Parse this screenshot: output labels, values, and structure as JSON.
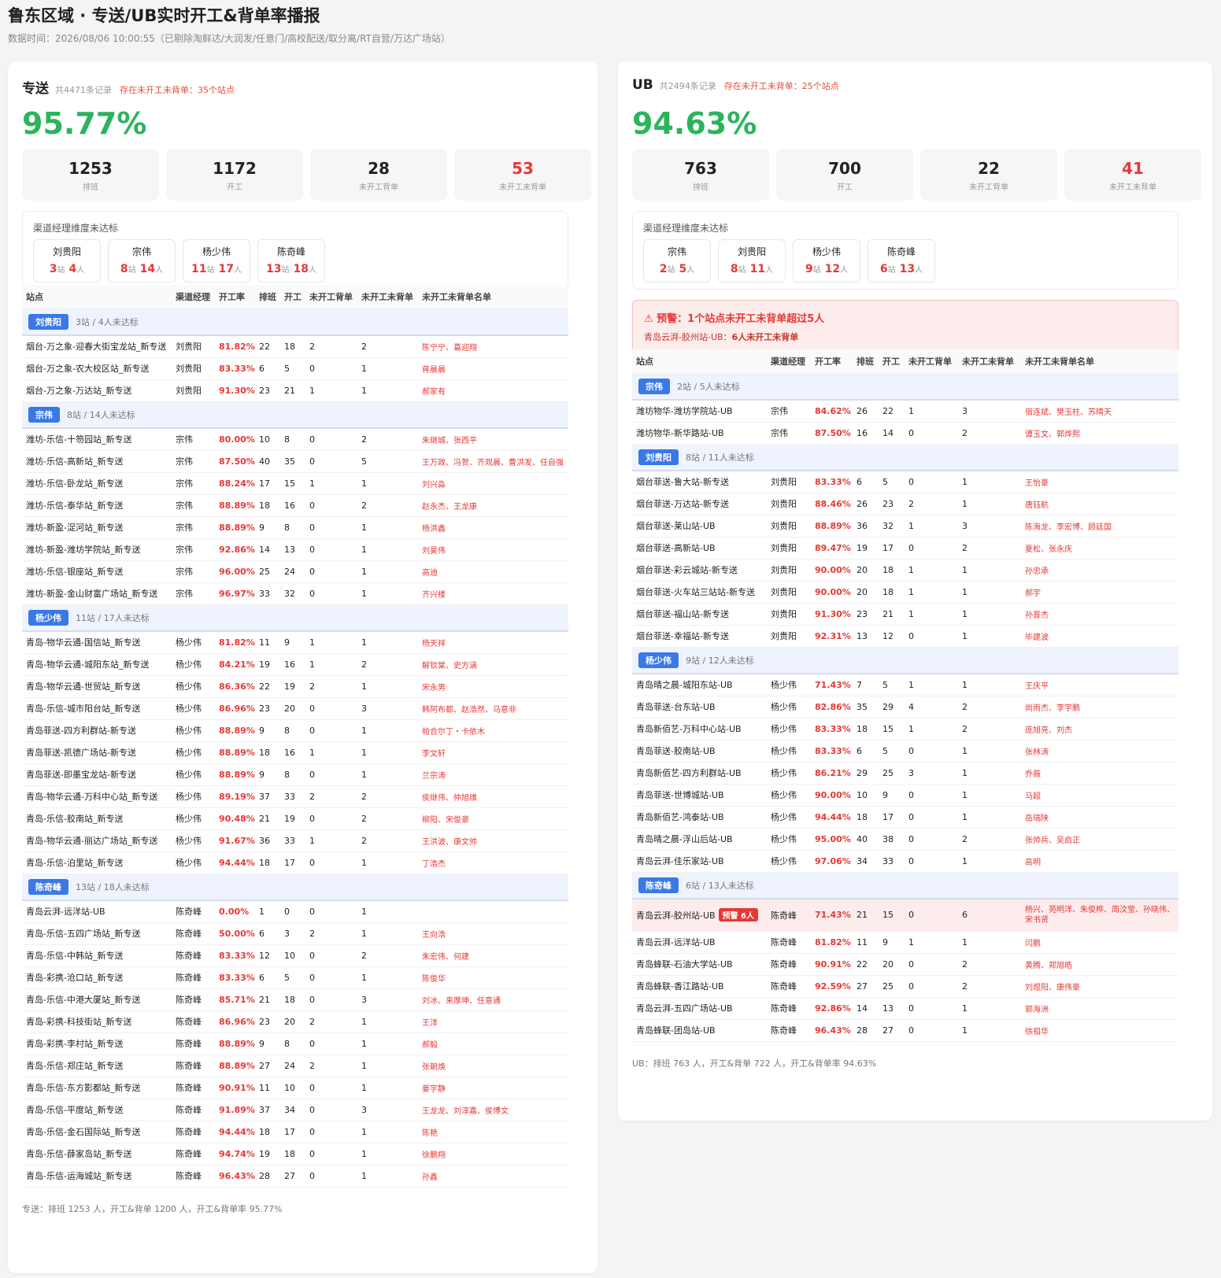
{
  "header": {
    "title": "鲁东区域 · 专送/UB实时开工&背单率播报",
    "subtitle": "数据时间：2026/08/06 10:00:55（已剔除淘鲜达/大润发/任意门/高校配送/取分离/RT自营/万达广场站）"
  },
  "left": {
    "name": "专送",
    "count": "共4471条记录",
    "warn": "存在未开工未背单：35个站点",
    "rate": "95.77%",
    "stats": [
      {
        "value": "1253",
        "label": "排班"
      },
      {
        "value": "1172",
        "label": "开工"
      },
      {
        "value": "28",
        "label": "未开工背单"
      },
      {
        "value": "53",
        "label": "未开工未背单"
      }
    ],
    "mgr_title": "渠道经理维度未达标",
    "managers": [
      {
        "name": "刘贵阳",
        "sites": "3",
        "people": "4"
      },
      {
        "name": "宗伟",
        "sites": "8",
        "people": "14"
      },
      {
        "name": "杨少伟",
        "sites": "11",
        "people": "17"
      },
      {
        "name": "陈奇峰",
        "sites": "13",
        "people": "18"
      }
    ],
    "unit_site": "站",
    "unit_people": "人",
    "columns": [
      "站点",
      "渠道经理",
      "开工率",
      "排班",
      "开工",
      "未开工背单",
      "未开工未背单",
      "未开工未背单名单"
    ],
    "groups": [
      {
        "manager": "刘贵阳",
        "summary": "3站 / 4人未达标",
        "rows": [
          [
            "烟台-万之象-迎春大街宝龙站_新专送",
            "刘贵阳",
            "81.82%",
            "22",
            "18",
            "2",
            "2",
            "陈宁宁、葛迎翔"
          ],
          [
            "烟台-万之象-农大校区站_新专送",
            "刘贵阳",
            "83.33%",
            "6",
            "5",
            "0",
            "1",
            "蒋晨晨"
          ],
          [
            "烟台-万之象-万达站_新专送",
            "刘贵阳",
            "91.30%",
            "23",
            "21",
            "1",
            "1",
            "郝家有"
          ]
        ]
      },
      {
        "manager": "宗伟",
        "summary": "8站 / 14人未达标",
        "rows": [
          [
            "潍坊-乐信-十笏园站_新专送",
            "宗伟",
            "80.00%",
            "10",
            "8",
            "0",
            "2",
            "朱继城、张西平"
          ],
          [
            "潍坊-乐信-高新站_新专送",
            "宗伟",
            "87.50%",
            "40",
            "35",
            "0",
            "5",
            "王万政、冯贺、齐观晨、曹洪发、任自强"
          ],
          [
            "潍坊-乐信-卧龙站_新专送",
            "宗伟",
            "88.24%",
            "17",
            "15",
            "1",
            "1",
            "刘兴淼"
          ],
          [
            "潍坊-乐信-泰华站_新专送",
            "宗伟",
            "88.89%",
            "18",
            "16",
            "0",
            "2",
            "赵永杰、王龙康"
          ],
          [
            "潍坊-新盈-浞河站_新专送",
            "宗伟",
            "88.89%",
            "9",
            "8",
            "0",
            "1",
            "杨洪鑫"
          ],
          [
            "潍坊-新盈-潍坊学院站_新专送",
            "宗伟",
            "92.86%",
            "14",
            "13",
            "0",
            "1",
            "刘昊伟"
          ],
          [
            "潍坊-乐信-银座站_新专送",
            "宗伟",
            "96.00%",
            "25",
            "24",
            "0",
            "1",
            "高迪"
          ],
          [
            "潍坊-新盈-金山财富广场站_新专送",
            "宗伟",
            "96.97%",
            "33",
            "32",
            "0",
            "1",
            "齐兴楼"
          ]
        ]
      },
      {
        "manager": "杨少伟",
        "summary": "11站 / 17人未达标",
        "rows": [
          [
            "青岛-物华云通-国信站_新专送",
            "杨少伟",
            "81.82%",
            "11",
            "9",
            "1",
            "1",
            "杨天祥"
          ],
          [
            "青岛-物华云通-城阳东站_新专送",
            "杨少伟",
            "84.21%",
            "19",
            "16",
            "1",
            "2",
            "解钦棠、史方涵"
          ],
          [
            "青岛-物华云通-世贸站_新专送",
            "杨少伟",
            "86.36%",
            "22",
            "19",
            "2",
            "1",
            "宋永男"
          ],
          [
            "青岛-乐信-城市阳台站_新专送",
            "杨少伟",
            "86.96%",
            "23",
            "20",
            "0",
            "3",
            "韩阿布都、赵浩然、马意非"
          ],
          [
            "青岛菲送-四方利群站-新专送",
            "杨少伟",
            "88.89%",
            "9",
            "8",
            "0",
            "1",
            "帕合尔丁・卡依木"
          ],
          [
            "青岛菲送-凯德广场站-新专送",
            "杨少伟",
            "88.89%",
            "18",
            "16",
            "1",
            "1",
            "李文轩"
          ],
          [
            "青岛菲送-即墨宝龙站-新专送",
            "杨少伟",
            "88.89%",
            "9",
            "8",
            "0",
            "1",
            "兰宗涛"
          ],
          [
            "青岛-物华云通-万科中心站_新专送",
            "杨少伟",
            "89.19%",
            "37",
            "33",
            "2",
            "2",
            "侯继伟、仲旭维"
          ],
          [
            "青岛-乐信-胶南站_新专送",
            "杨少伟",
            "90.48%",
            "21",
            "19",
            "0",
            "2",
            "柳阳、宋俊豪"
          ],
          [
            "青岛-物华云通-丽达广场站_新专送",
            "杨少伟",
            "91.67%",
            "36",
            "33",
            "1",
            "2",
            "王洪波、康文帅"
          ],
          [
            "青岛-乐信-泊里站_新专送",
            "杨少伟",
            "94.44%",
            "18",
            "17",
            "0",
            "1",
            "丁浩杰"
          ]
        ]
      },
      {
        "manager": "陈奇峰",
        "summary": "13站 / 18人未达标",
        "rows": [
          [
            "青岛云湃-远洋站-UB",
            "陈奇峰",
            "0.00%",
            "1",
            "0",
            "0",
            "1",
            ""
          ],
          [
            "青岛-乐信-五四广场站_新专送",
            "陈奇峰",
            "50.00%",
            "6",
            "3",
            "2",
            "1",
            "王向浩"
          ],
          [
            "青岛-乐信-中韩站_新专送",
            "陈奇峰",
            "83.33%",
            "12",
            "10",
            "0",
            "2",
            "朱宏伟、何建"
          ],
          [
            "青岛-彩携-沧口站_新专送",
            "陈奇峰",
            "83.33%",
            "6",
            "5",
            "0",
            "1",
            "陈俊华"
          ],
          [
            "青岛-乐信-中港大厦站_新专送",
            "陈奇峰",
            "85.71%",
            "21",
            "18",
            "0",
            "3",
            "刘冰、来厚坤、任意通"
          ],
          [
            "青岛-彩携-科技街站_新专送",
            "陈奇峰",
            "86.96%",
            "23",
            "20",
            "2",
            "1",
            "王洋"
          ],
          [
            "青岛-彩携-李村站_新专送",
            "陈奇峰",
            "88.89%",
            "9",
            "8",
            "0",
            "1",
            "郝毅"
          ],
          [
            "青岛-乐信-郑庄站_新专送",
            "陈奇峰",
            "88.89%",
            "27",
            "24",
            "2",
            "1",
            "张朝焕"
          ],
          [
            "青岛-乐信-东方影都站_新专送",
            "陈奇峰",
            "90.91%",
            "11",
            "10",
            "0",
            "1",
            "姜宇静"
          ],
          [
            "青岛-乐信-平度站_新专送",
            "陈奇峰",
            "91.89%",
            "37",
            "34",
            "0",
            "3",
            "王龙龙、刘淳嘉、侯博文"
          ],
          [
            "青岛-乐信-金石国际站_新专送",
            "陈奇峰",
            "94.44%",
            "18",
            "17",
            "0",
            "1",
            "陈艳"
          ],
          [
            "青岛-乐信-薛家岛站_新专送",
            "陈奇峰",
            "94.74%",
            "19",
            "18",
            "0",
            "1",
            "徐鹏翔"
          ],
          [
            "青岛-乐信-运海城站_新专送",
            "陈奇峰",
            "96.43%",
            "28",
            "27",
            "0",
            "1",
            "孙鑫"
          ]
        ]
      }
    ],
    "footer": "专送：排班 1253 人，开工&背单 1200 人，开工&背单率 95.77%"
  },
  "right": {
    "name": "UB",
    "count": "共2494条记录",
    "warn": "存在未开工未背单：25个站点",
    "rate": "94.63%",
    "stats": [
      {
        "value": "763",
        "label": "排班"
      },
      {
        "value": "700",
        "label": "开工"
      },
      {
        "value": "22",
        "label": "未开工背单"
      },
      {
        "value": "41",
        "label": "未开工未背单"
      }
    ],
    "mgr_title": "渠道经理维度未达标",
    "managers": [
      {
        "name": "宗伟",
        "sites": "2",
        "people": "5"
      },
      {
        "name": "刘贵阳",
        "sites": "8",
        "people": "11"
      },
      {
        "name": "杨少伟",
        "sites": "9",
        "people": "12"
      },
      {
        "name": "陈奇峰",
        "sites": "6",
        "people": "13"
      }
    ],
    "unit_site": "站",
    "unit_people": "人",
    "alert": {
      "title": "⚠ 预警：1个站点未开工未背单超过5人",
      "site": "青岛云湃-胶州站-UB：",
      "detail": "6人未开工未背单"
    },
    "columns": [
      "站点",
      "渠道经理",
      "开工率",
      "排班",
      "开工",
      "未开工背单",
      "未开工未背单",
      "未开工未背单名单"
    ],
    "groups": [
      {
        "manager": "宗伟",
        "summary": "2站 / 5人未达标",
        "rows": [
          [
            "潍坊物华-潍坊学院站-UB",
            "宗伟",
            "84.62%",
            "26",
            "22",
            "1",
            "3",
            "宿连斌、樊玉柱、苏晴天"
          ],
          [
            "潍坊物华-新华路站-UB",
            "宗伟",
            "87.50%",
            "16",
            "14",
            "0",
            "2",
            "谭玉文、郭烨熙"
          ]
        ]
      },
      {
        "manager": "刘贵阳",
        "summary": "8站 / 11人未达标",
        "rows": [
          [
            "烟台菲送-鲁大站-新专送",
            "刘贵阳",
            "83.33%",
            "6",
            "5",
            "0",
            "1",
            "王怡豪"
          ],
          [
            "烟台菲送-万达站-新专送",
            "刘贵阳",
            "88.46%",
            "26",
            "23",
            "2",
            "1",
            "唐钰航"
          ],
          [
            "烟台菲送-莱山站-UB",
            "刘贵阳",
            "88.89%",
            "36",
            "32",
            "1",
            "3",
            "陈海龙、李宏博、顾廷国"
          ],
          [
            "烟台菲送-高新站-UB",
            "刘贵阳",
            "89.47%",
            "19",
            "17",
            "0",
            "2",
            "夏松、张永庆"
          ],
          [
            "烟台菲送-彩云城站-新专送",
            "刘贵阳",
            "90.00%",
            "20",
            "18",
            "1",
            "1",
            "孙忠承"
          ],
          [
            "烟台菲送-火车站三站站-新专送",
            "刘贵阳",
            "90.00%",
            "20",
            "18",
            "1",
            "1",
            "郝宇"
          ],
          [
            "烟台菲送-福山站-新专送",
            "刘贵阳",
            "91.30%",
            "23",
            "21",
            "1",
            "1",
            "孙晋杰"
          ],
          [
            "烟台菲送-幸福站-新专送",
            "刘贵阳",
            "92.31%",
            "13",
            "12",
            "0",
            "1",
            "毕建波"
          ]
        ]
      },
      {
        "manager": "杨少伟",
        "summary": "9站 / 12人未达标",
        "rows": [
          [
            "青岛晴之晨-城阳东站-UB",
            "杨少伟",
            "71.43%",
            "7",
            "5",
            "1",
            "1",
            "王庆平"
          ],
          [
            "青岛菲送-台东站-UB",
            "杨少伟",
            "82.86%",
            "35",
            "29",
            "4",
            "2",
            "尚雨杰、李宇鹏"
          ],
          [
            "青岛新佰艺-万科中心站-UB",
            "杨少伟",
            "83.33%",
            "18",
            "15",
            "1",
            "2",
            "庞旭亮、刘杰"
          ],
          [
            "青岛菲送-胶南站-UB",
            "杨少伟",
            "83.33%",
            "6",
            "5",
            "0",
            "1",
            "张林涛"
          ],
          [
            "青岛新佰艺-四方利群站-UB",
            "杨少伟",
            "86.21%",
            "29",
            "25",
            "3",
            "1",
            "乔薇"
          ],
          [
            "青岛菲送-世博城站-UB",
            "杨少伟",
            "90.00%",
            "10",
            "9",
            "0",
            "1",
            "马超"
          ],
          [
            "青岛新佰艺-鸿泰站-UB",
            "杨少伟",
            "94.44%",
            "18",
            "17",
            "0",
            "1",
            "岳瑞陕"
          ],
          [
            "青岛晴之晨-浮山后站-UB",
            "杨少伟",
            "95.00%",
            "40",
            "38",
            "0",
            "2",
            "张帅兵、吴启正"
          ],
          [
            "青岛云湃-佳乐家站-UB",
            "杨少伟",
            "97.06%",
            "34",
            "33",
            "0",
            "1",
            "高明"
          ]
        ]
      },
      {
        "manager": "陈奇峰",
        "summary": "6站 / 13人未达标",
        "rows": [
          [
            "青岛云湃-胶州站-UB",
            "陈奇峰",
            "71.43%",
            "21",
            "15",
            "0",
            "6",
            "杨兴、苑明洋、朱俊桦、周汶莹、孙晓伟、宋书贤"
          ],
          [
            "青岛云湃-远洋站-UB",
            "陈奇峰",
            "81.82%",
            "11",
            "9",
            "1",
            "1",
            "闫鹏"
          ],
          [
            "青岛蜂联-石油大学站-UB",
            "陈奇峰",
            "90.91%",
            "22",
            "20",
            "0",
            "2",
            "黄腾、郑旭皓"
          ],
          [
            "青岛蜂联-香江路站-UB",
            "陈奇峰",
            "92.59%",
            "27",
            "25",
            "0",
            "2",
            "刘煜阳、康伟豪"
          ],
          [
            "青岛云湃-五四广场站-UB",
            "陈奇峰",
            "92.86%",
            "14",
            "13",
            "0",
            "1",
            "郭海洲"
          ],
          [
            "青岛蜂联-团岛站-UB",
            "陈奇峰",
            "96.43%",
            "28",
            "27",
            "0",
            "1",
            "徐祖华"
          ]
        ]
      }
    ],
    "warn_badge": "预警 6人",
    "footer": "UB：排班 763 人，开工&背单 722 人，开工&背单率 94.63%"
  },
  "colors": {
    "green": "#2bb45c",
    "red": "#e53935",
    "blue": "#3a78e6"
  }
}
